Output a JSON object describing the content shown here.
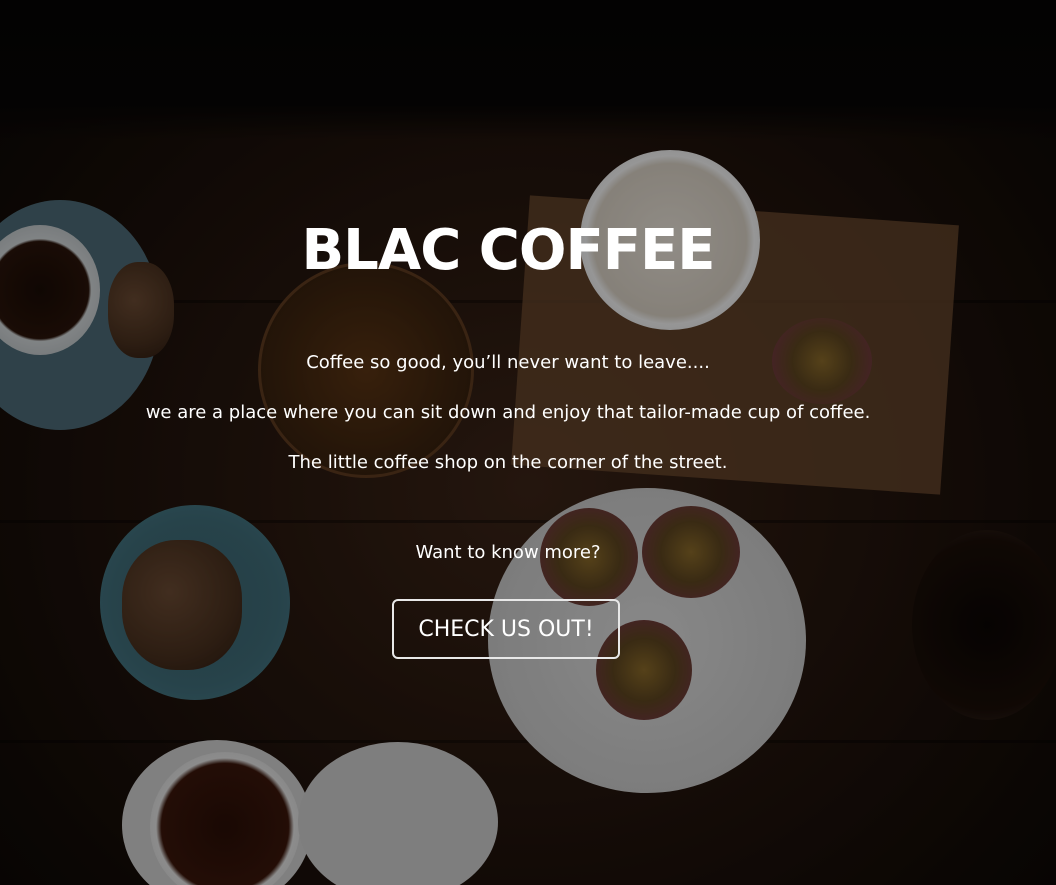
{
  "hero": {
    "title": "BLAC COFFEE",
    "tagline": "Coffee so good, you’ll never want to leave....",
    "description": "we are a place where you can sit down and enjoy that tailor-made cup of coffee.",
    "location": "The little coffee shop on the corner of the street.",
    "prompt": "Want to know more?",
    "cta_label": "CHECK US OUT!"
  },
  "colors": {
    "text": "#ffffff",
    "button_border": "#e8e8e8",
    "background": "#24150d"
  },
  "background_image": "overhead-coffee-table-photo"
}
